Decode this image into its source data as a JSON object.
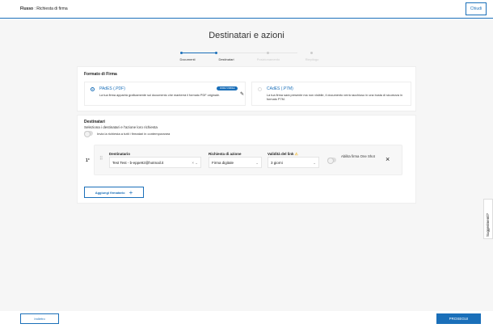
{
  "header": {
    "flow_label": "Flusso",
    "flow_name": "Richiesta di firma",
    "close_label": "Chiudi"
  },
  "page_title": "Destinatari e azioni",
  "steps": [
    {
      "label": "Documenti",
      "state": "done"
    },
    {
      "label": "Destinatari",
      "state": "active"
    },
    {
      "label": "Posizionamento",
      "state": "pending"
    },
    {
      "label": "Riepilogo",
      "state": "pending"
    }
  ],
  "format": {
    "title": "Formato di Firma",
    "options": [
      {
        "label": "PAdES (.PDF)",
        "badge": "FIRMA VISIBILE",
        "desc": "La tua firma apparirà graficamente sul documento che manterrà il formato PDF originale.",
        "selected": true
      },
      {
        "label": "CAdES (.P7M)",
        "desc": "La tua firma sarà presente ma non visibile, il documento verrà racchiuso in una busta di sicurezza in formato P7M.",
        "selected": false
      }
    ]
  },
  "recipients": {
    "title": "Destinatari",
    "subtitle": "Seleziona i destinatari e l'azione loro richiesta",
    "toggle_label": "Invia la richiesta a tutti i firmatari in contemporanea",
    "toggle_on": false,
    "rows": [
      {
        "index": "1°",
        "recipient_label": "Destinatario",
        "recipient_value": "Test Test - b-eppe92@hotmail.it",
        "action_label": "Richiesta di azione",
        "action_value": "Firma digitale",
        "validity_label": "Validità del link",
        "validity_value": "3 giorni",
        "oneshot_label": "Abilita firma One Shot",
        "oneshot_on": false
      }
    ],
    "add_label": "Aggiungi firmatario"
  },
  "suggestions_label": "Suggerimenti?",
  "footer": {
    "back_label": "Indietro",
    "next_label": "PROSEGUI"
  },
  "colors": {
    "accent": "#1a6fb9",
    "warning": "#f0b429"
  }
}
